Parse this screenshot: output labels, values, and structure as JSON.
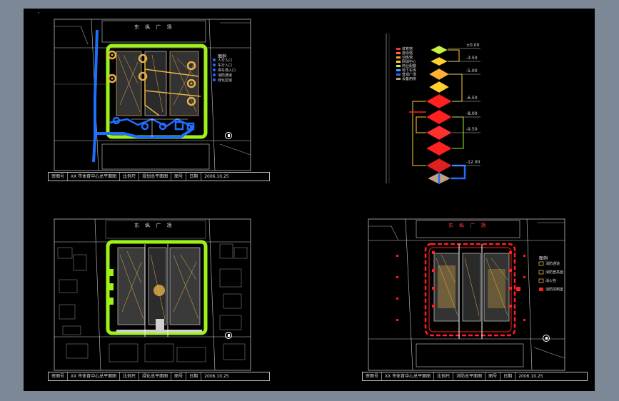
{
  "sheets": [
    {
      "id": "a",
      "street": "东 纵 广 场",
      "legend": {
        "title": "图例",
        "items": [
          "人行入口",
          "车行入口",
          "停车场入口",
          "消防通道",
          "绿化区域"
        ]
      },
      "title_block": [
        "审图号",
        "XX 市体育中心总平面图",
        "比例尺",
        "规划总平面图",
        "图号",
        "日期",
        "2006.10.25"
      ]
    },
    {
      "id": "b",
      "legend_items": [
        "体育馆",
        "游泳馆",
        "训练馆",
        "网球中心",
        "商业配套",
        "地下车库",
        "景观广场",
        "设备用房"
      ],
      "labels": [
        "±0.00",
        "-3.50",
        "-5.00",
        "-6.50",
        "-8.00",
        "-9.50",
        "-12.00"
      ]
    },
    {
      "id": "c",
      "street": "东 纵 广 场",
      "title_block": [
        "审图号",
        "XX 市体育中心总平面图",
        "比例尺",
        "绿化总平面图",
        "图号",
        "日期",
        "2006.10.25"
      ]
    },
    {
      "id": "d",
      "street": "东 纵 广 场",
      "legend": {
        "title": "图例",
        "items": [
          "消防通道",
          "消防登高面",
          "消火栓",
          "消防控制室"
        ]
      },
      "title_block": [
        "审图号",
        "XX 市体育中心总平面图",
        "比例尺",
        "消防总平面图",
        "图号",
        "日期",
        "2006.10.25"
      ]
    }
  ],
  "colors": {
    "green": "#9ef21a",
    "blue": "#1f6fff",
    "orange": "#e6b24a",
    "red": "#ff2020",
    "grey": "#d0d0d0"
  }
}
